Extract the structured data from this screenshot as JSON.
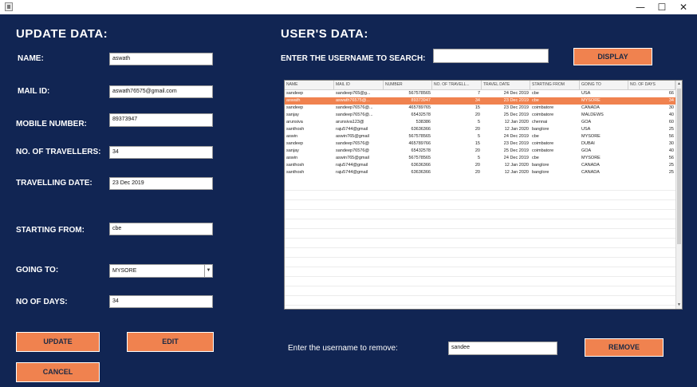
{
  "window": {
    "minimize": "—",
    "maximize": "☐",
    "close": "✕"
  },
  "left": {
    "heading": "UPDATE DATA:",
    "name": {
      "label": "NAME:",
      "value": "aswath"
    },
    "mail": {
      "label": "MAIL ID:",
      "value": "aswath76575@gmail.com"
    },
    "mobile": {
      "label": "MOBILE NUMBER:",
      "value": "89373947"
    },
    "travellers": {
      "label": "NO. OF TRAVELLERS:",
      "value": "34"
    },
    "date": {
      "label": "TRAVELLING DATE:",
      "value": "23 Dec 2019"
    },
    "starting": {
      "label": "STARTING FROM:",
      "value": "cbe"
    },
    "going": {
      "label": "GOING TO:",
      "value": "MYSORE"
    },
    "days": {
      "label": "NO OF DAYS:",
      "value": "34"
    },
    "update_btn": "UPDATE",
    "edit_btn": "EDIT",
    "cancel_btn": "CANCEL"
  },
  "right": {
    "heading": "USER'S DATA:",
    "search_label": "ENTER THE USERNAME TO SEARCH:",
    "search_value": "",
    "display_btn": "DISPLAY",
    "remove_label": "Enter the username to remove:",
    "remove_value": "sandee",
    "remove_btn": "REMOVE"
  },
  "table": {
    "columns": [
      "NAME",
      "MAIL ID",
      "NUMBER",
      "NO. OF TRAVELL...",
      "TRAVEL DATE",
      "STARTING FROM",
      "GOING TO",
      "NO. OF DAYS"
    ],
    "rows": [
      [
        "sandeep",
        "sandeep765@g...",
        "567578565",
        "7",
        "24 Dec 2019",
        "cbe",
        "USA",
        "66"
      ],
      [
        "aswath",
        "aswath76575@...",
        "89373947",
        "34",
        "23 Dec 2019",
        "cbe",
        "MYSORE",
        "34"
      ],
      [
        "sandeep",
        "sandeep76576@...",
        "465789765",
        "15",
        "23 Dec 2019",
        "coimbatore",
        "CANADA",
        "30"
      ],
      [
        "sanjay",
        "sandeep76576@...",
        "65432578",
        "20",
        "25 Dec 2019",
        "coimbatore",
        "MALDEWS",
        "40"
      ],
      [
        "arunsiva",
        "arunsiva123@",
        "538386",
        "5",
        "12 Jan 2020",
        "chennai",
        "GOA",
        "60"
      ],
      [
        "santhosh",
        "raju5744@gmail",
        "63636366",
        "20",
        "12 Jan 2020",
        "banglore",
        "USA",
        "25"
      ],
      [
        "aswin",
        "aswin765@gmail",
        "567578565",
        "5",
        "24 Dec 2019",
        "cbe",
        "MYSORE",
        "56"
      ],
      [
        "sandeep",
        "sandeep76576@",
        "465789766",
        "15",
        "23 Dec 2019",
        "coimbatore",
        "DUBAI",
        "30"
      ],
      [
        "sanjay",
        "sandeep76576@",
        "65432578",
        "20",
        "25 Dec 2019",
        "coimbatore",
        "GOA",
        "40"
      ],
      [
        "aswin",
        "aswin765@gmail",
        "567578565",
        "5",
        "24 Dec 2019",
        "cbe",
        "MYSORE",
        "56"
      ],
      [
        "santhosh",
        "raju5744@gmail",
        "63636366",
        "20",
        "12 Jan 2020",
        "banglore",
        "CANADA",
        "25"
      ],
      [
        "santhosh",
        "raju5744@gmail",
        "63636366",
        "20",
        "12 Jan 2020",
        "banglore",
        "CANADA",
        "25"
      ]
    ],
    "selected_row": 1
  }
}
